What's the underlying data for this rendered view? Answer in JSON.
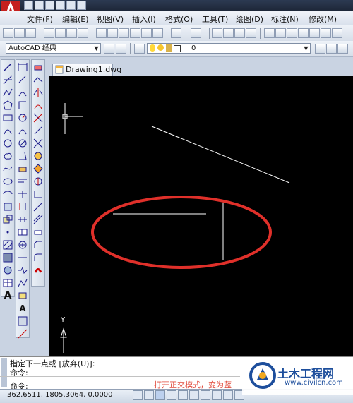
{
  "colors": {
    "canvas": "#000000",
    "highlight_ellipse": "#e0302a",
    "drawing_lines": "#ffffff",
    "annotation": "#e14b3c",
    "watermark": "#1d4e9c"
  },
  "menu": [
    "文件(F)",
    "编辑(E)",
    "视图(V)",
    "插入(I)",
    "格式(O)",
    "工具(T)",
    "绘图(D)",
    "标注(N)",
    "修改(M)"
  ],
  "toolbar": {
    "workspace": "AutoCAD 经典",
    "layer": "0"
  },
  "icons": {
    "app": "autocad-logo-icon",
    "quick_access": [
      "new-icon",
      "open-icon",
      "save-icon",
      "print-icon",
      "undo-icon",
      "redo-icon"
    ],
    "standard": [
      "qnew-icon",
      "open-icon",
      "save-icon",
      "plot-icon",
      "preview-icon",
      "publish-icon",
      "cut-icon",
      "copy-icon",
      "paste-icon",
      "match-icon",
      "block-icon",
      "undo-icon",
      "redo-icon",
      "pan-icon",
      "zoom-realtime-icon",
      "zoom-window-icon",
      "zoom-prev-icon",
      "properties-icon",
      "design-center-icon",
      "tool-palettes-icon",
      "sheet-set-icon",
      "markup-icon",
      "calculator-icon"
    ],
    "draw_bar": [
      "line-icon",
      "construction-line-icon",
      "polyline-icon",
      "polygon-icon",
      "rectangle-icon",
      "arc-icon",
      "circle-icon",
      "revcloud-icon",
      "spline-icon",
      "ellipse-icon",
      "ellipse-arc-icon",
      "insert-block-icon",
      "make-block-icon",
      "point-icon",
      "hatch-icon",
      "gradient-icon",
      "region-icon",
      "table-icon",
      "text-icon"
    ],
    "modify_bar": [
      "erase-icon",
      "copy-object-icon",
      "mirror-icon",
      "offset-icon",
      "array-icon",
      "move-icon",
      "rotate-icon",
      "scale-icon",
      "stretch-icon",
      "trim-icon",
      "extend-icon",
      "break-point-icon",
      "break-icon",
      "join-icon",
      "chamfer-icon",
      "fillet-icon",
      "explode-icon"
    ],
    "dim_bar": [
      "linear-dim-icon",
      "aligned-dim-icon",
      "arc-length-icon",
      "ordinate-icon",
      "radius-icon",
      "jogged-icon",
      "diameter-icon",
      "angular-icon",
      "quick-dim-icon",
      "baseline-icon",
      "continue-icon",
      "dim-space-icon",
      "dim-break-icon",
      "tolerance-icon",
      "center-mark-icon",
      "inspect-icon",
      "jog-linear-icon",
      "dim-edit-icon",
      "dim-text-edit-icon",
      "dim-update-icon",
      "dim-style-icon"
    ],
    "layer_state": [
      "lightbulb-icon",
      "sun-icon",
      "lock-icon",
      "color-square-icon"
    ]
  },
  "document": {
    "tab": "Drawing1.dwg",
    "ucs_label": "Y"
  },
  "command": {
    "history": "指定下一点或 [放弃(U)]:",
    "line2": "命令:",
    "prompt": "命令:"
  },
  "status": {
    "coords": "362.6511,  1805.3064, 0.0000"
  },
  "annotation": "打开正交模式，变为蓝",
  "watermark": {
    "title": "土木工程网",
    "url": "www.civilcn.com"
  }
}
